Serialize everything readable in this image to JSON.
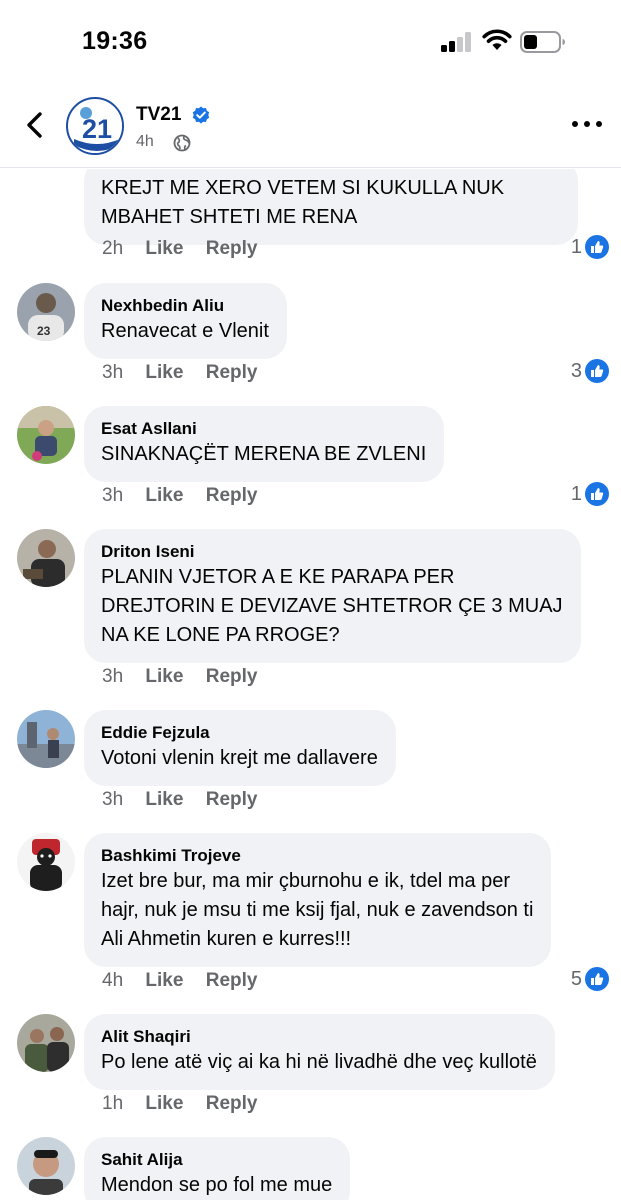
{
  "status_bar": {
    "time": "19:36"
  },
  "header": {
    "page_name": "TV21",
    "post_time": "4h",
    "avatar_text": "21"
  },
  "colors": {
    "accent": "#1b74e4",
    "bubble": "#f0f2f5",
    "meta": "#65676b"
  },
  "actions": {
    "like": "Like",
    "reply": "Reply"
  },
  "comments": [
    {
      "author": "",
      "text": "KREJT ME XERO VETEM SI KUKULLA NUK\nMBAHET SHTETI ME RENA",
      "time": "2h",
      "reactions": "1"
    },
    {
      "author": "Nexhbedin Aliu",
      "text": "Renavecat e Vlenit",
      "time": "3h",
      "reactions": "3"
    },
    {
      "author": "Esat Asllani",
      "text": "SINAKNAÇËT MERENA BE ZVLENI",
      "time": "3h",
      "reactions": "1"
    },
    {
      "author": "Driton Iseni",
      "text": "PLANIN VJETOR A E KE PARAPA PER\nDREJTORIN E DEVIZAVE SHTETROR ÇE 3 MUAJ\nNA KE LONE PA RROGE?",
      "time": "3h",
      "reactions": ""
    },
    {
      "author": "Eddie Fejzula",
      "text": "Votoni vlenin krejt me dallavere",
      "time": "3h",
      "reactions": ""
    },
    {
      "author": "Bashkimi Trojeve",
      "text": "Izet bre bur, ma mir çburnohu e ik, tdel ma per\nhajr, nuk je msu ti me ksij fjal, nuk e zavendson ti\nAli Ahmetin kuren e kurres!!!",
      "time": "4h",
      "reactions": "5"
    },
    {
      "author": "Alit Shaqiri",
      "text": "Po lene atë viç ai ka hi në livadhë dhe veç kullotë",
      "time": "1h",
      "reactions": ""
    },
    {
      "author": "Sahit Alija",
      "text": "Mendon se po fol me mue",
      "time": "",
      "reactions": ""
    }
  ]
}
